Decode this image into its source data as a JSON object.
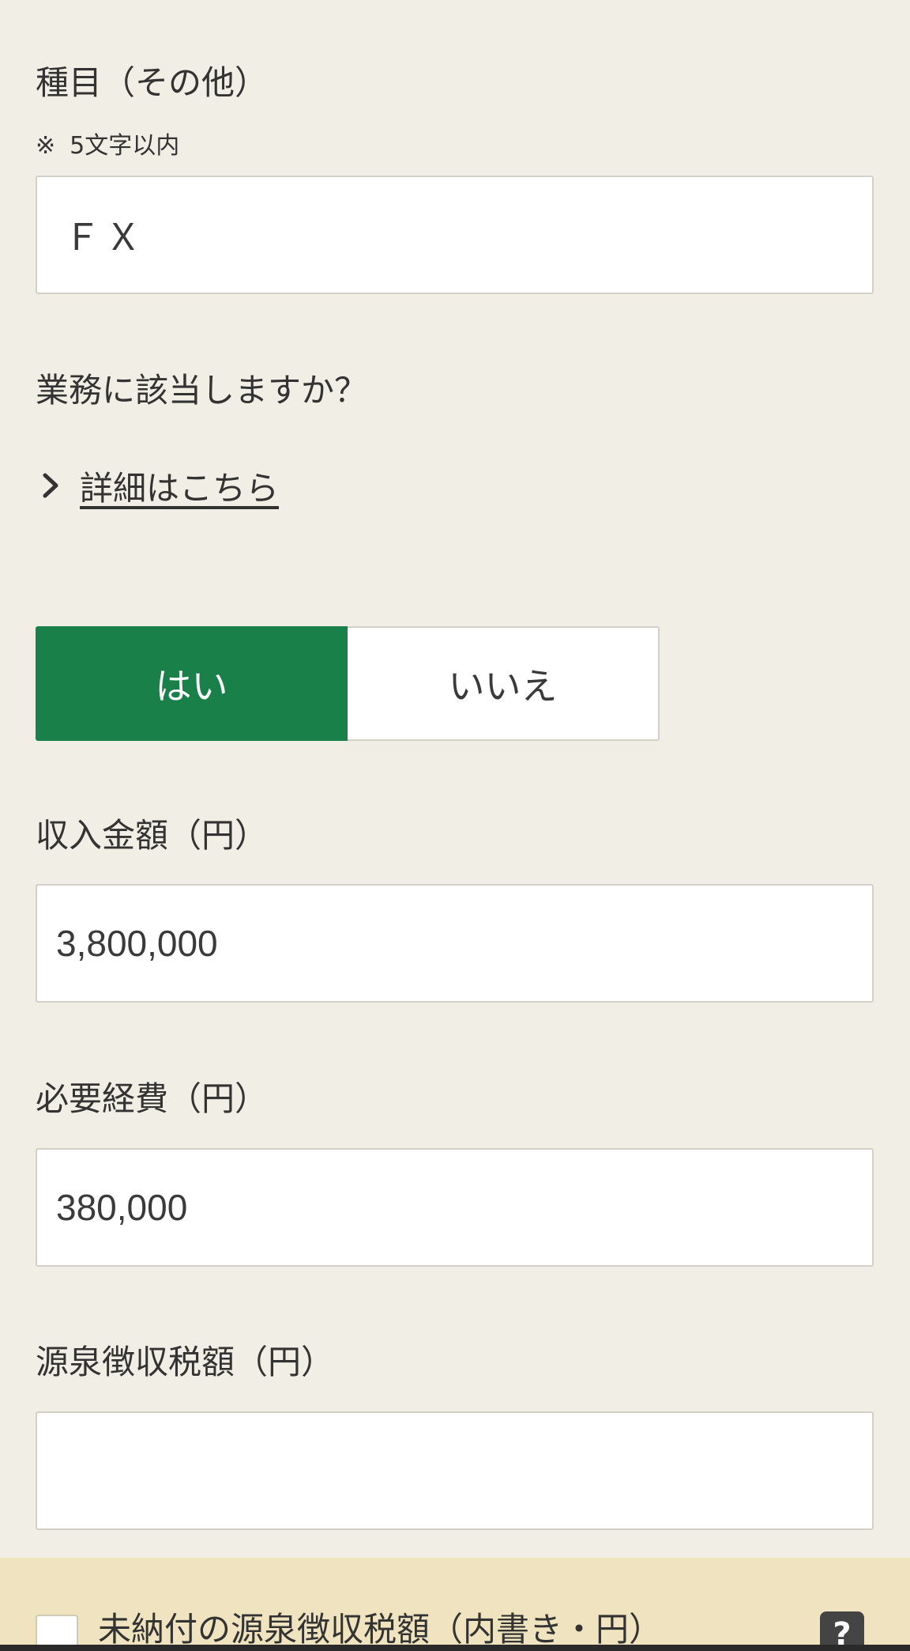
{
  "category": {
    "label": "種目（その他）",
    "note_mark": "※",
    "note_text": "5文字以内",
    "value": "ＦＸ"
  },
  "business_question": {
    "label": "業務に該当しますか？",
    "detail_link": "詳細はこちら",
    "yes_label": "はい",
    "no_label": "いいえ",
    "selected": "はい"
  },
  "income": {
    "label": "収入金額（円）",
    "value": "3,800,000"
  },
  "expenses": {
    "label": "必要経費（円）",
    "value": "380,000"
  },
  "withholding": {
    "label": "源泉徴収税額（円）",
    "value": ""
  },
  "unpaid_withholding": {
    "label": "未納付の源泉徴収税額（内書き・円）",
    "help_icon": "?"
  },
  "colors": {
    "background": "#f1efe5",
    "selected_green": "#1a804a",
    "notice_band": "#efe4bf"
  }
}
